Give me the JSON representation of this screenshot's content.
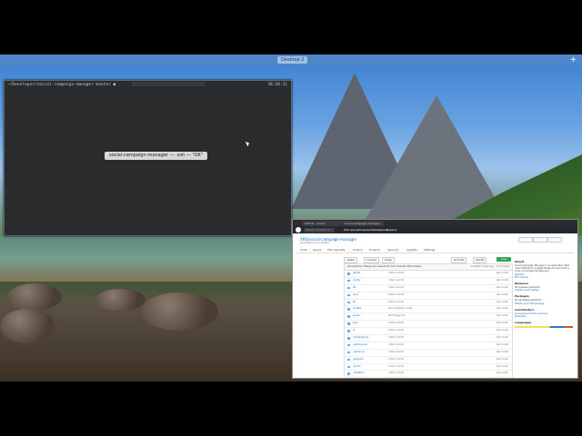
{
  "desktop": {
    "label": "Desktop 2",
    "add_symbol": "+"
  },
  "terminal": {
    "prompt": "~/Developer/social-campaign-manager master ●",
    "time": "18:20:11",
    "toast": "social-campaign-manager — .ssh — \"OK\""
  },
  "browser": {
    "tabs": [
      "GitHub · social-campaign...",
      "social-campaign-manager"
    ],
    "nav": {
      "search": "Search or jump to...",
      "items": [
        "Pull requests",
        "Issues",
        "Marketplace",
        "Explore"
      ]
    },
    "repo": {
      "title": "XRIL/social-campaign-manager",
      "subtitle": "generated from template",
      "tabs": [
        "Code",
        "Issues",
        "Pull requests",
        "Actions",
        "Projects",
        "Security",
        "Insights",
        "Settings"
      ],
      "branch": "master",
      "branches": "1 branch",
      "tags": "0 tags",
      "go_to_file": "Go to file",
      "add_file": "Add file",
      "code_button": "Code",
      "commit_msg": "princejohnson Merge pull request #1 from jrhamilton/fix-problem",
      "commit_meta": "eced6e7 2 days ago · 15 commits",
      "files": [
        {
          "name": "github",
          "msg": "Initial commit",
          "date": "last month"
        },
        {
          "name": "config",
          "msg": "Initial commit",
          "date": "last month"
        },
        {
          "name": "db",
          "msg": "Initial commit",
          "date": "last month"
        },
        {
          "name": "docs",
          "msg": "Initial commit",
          "date": "last month"
        },
        {
          "name": "lib",
          "msg": "Initial commit",
          "date": "last month"
        },
        {
          "name": "models",
          "msg": "Add integration tests",
          "date": "last month"
        },
        {
          "name": "server",
          "msg": "MVP Trigger fix",
          "date": "last month"
        },
        {
          "name": "test",
          "msg": "Initial commit",
          "date": "last month"
        },
        {
          "name": "ui",
          "msg": "Initial commit",
          "date": "last month"
        },
        {
          "name": ".dockerignore",
          "msg": "Initial commit",
          "date": "last month"
        },
        {
          "name": ".eslintignore",
          "msg": "Initial commit",
          "date": "last month"
        },
        {
          "name": ".eslintrc.js",
          "msg": "Initial commit",
          "date": "last month"
        },
        {
          "name": ".gitignore",
          "msg": "Initial commit",
          "date": "last month"
        },
        {
          "name": ".npmrc",
          "msg": "Initial commit",
          "date": "last month"
        },
        {
          "name": ".prettierrc",
          "msg": "Initial commit",
          "date": "last month"
        },
        {
          "name": "Dockerfile.prod",
          "msg": "Initial commit",
          "date": "last month"
        },
        {
          "name": "Dockerfile.dev",
          "msg": "Initial commit",
          "date": "last month"
        }
      ]
    },
    "sidebar": {
      "about_h": "About",
      "about_t": "Social Campaign Manager is an application that uses Chatbots to engage Facebook users with a cross conversational approach",
      "links": [
        "Readme",
        "MIT License"
      ],
      "releases_h": "Releases",
      "releases_t": "No releases published",
      "releases_l": "Create a new release",
      "packages_h": "Packages",
      "packages_t": "No packages published",
      "packages_l": "Publish your first package",
      "contributors_h": "Contributors",
      "contributors": [
        "princejohnson Prince Johnson",
        "jrhamilton"
      ],
      "languages_h": "Languages"
    }
  }
}
